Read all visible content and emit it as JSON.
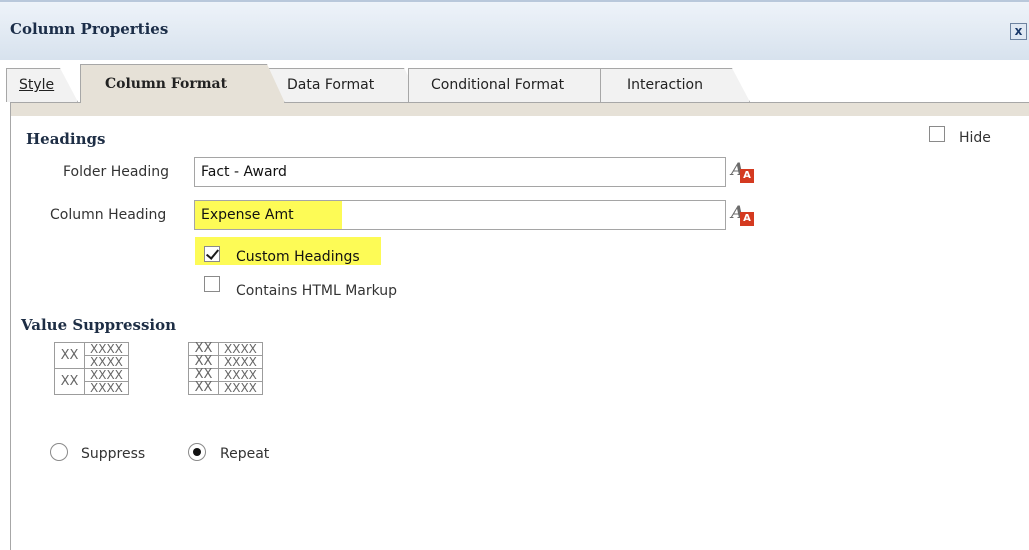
{
  "dialog": {
    "title": "Column Properties",
    "close_label": "x"
  },
  "tabs": [
    {
      "label": "Style"
    },
    {
      "label": "Column Format"
    },
    {
      "label": "Data Format"
    },
    {
      "label": "Conditional Format"
    },
    {
      "label": "Interaction"
    }
  ],
  "headings": {
    "section_title": "Headings",
    "hide_label": "Hide",
    "hide_checked": false,
    "folder_heading_label": "Folder Heading",
    "folder_heading_value": "Fact - Award",
    "column_heading_label": "Column Heading",
    "column_heading_value": "Expense Amt",
    "custom_headings_label": "Custom Headings",
    "custom_headings_checked": true,
    "html_markup_label": "Contains HTML Markup",
    "html_markup_checked": false,
    "format_icon_glyph": "A"
  },
  "value_suppression": {
    "section_title": "Value Suppression",
    "suppress_preview": {
      "group_label": "XX",
      "cell": "XXXX"
    },
    "repeat_preview": {
      "group_label": "XX",
      "cell": "XXXX"
    },
    "suppress_label": "Suppress",
    "repeat_label": "Repeat",
    "selected": "Repeat"
  },
  "colors": {
    "highlight": "#fdfb56",
    "active_tab": "#e6e1d7",
    "icon_red": "#d43a20"
  }
}
